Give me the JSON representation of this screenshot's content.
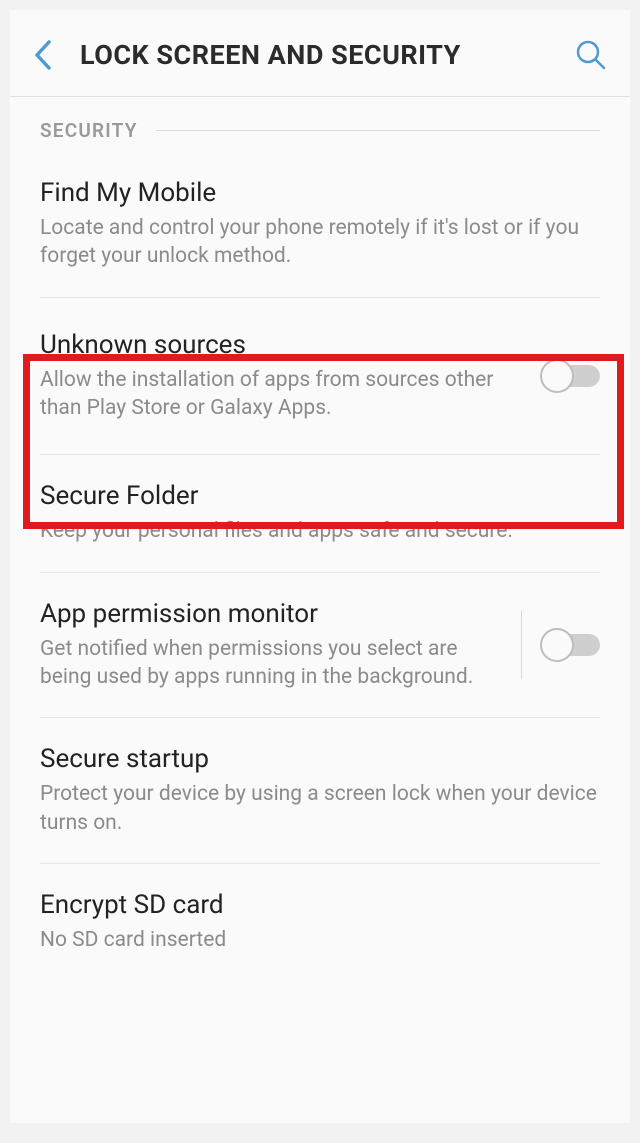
{
  "header": {
    "title": "LOCK SCREEN AND SECURITY"
  },
  "section": {
    "label": "SECURITY"
  },
  "items": {
    "find_my_mobile": {
      "title": "Find My Mobile",
      "desc": "Locate and control your phone remotely if it's lost or if you forget your unlock method."
    },
    "unknown_sources": {
      "title": "Unknown sources",
      "desc": "Allow the installation of apps from sources other than Play Store or Galaxy Apps."
    },
    "secure_folder": {
      "title": "Secure Folder",
      "desc": "Keep your personal files and apps safe and secure."
    },
    "app_permission_monitor": {
      "title": "App permission monitor",
      "desc": "Get notified when permissions you select are being used by apps running in the background."
    },
    "secure_startup": {
      "title": "Secure startup",
      "desc": "Protect your device by using a screen lock when your device turns on."
    },
    "encrypt_sd": {
      "title": "Encrypt SD card",
      "desc": "No SD card inserted"
    }
  }
}
